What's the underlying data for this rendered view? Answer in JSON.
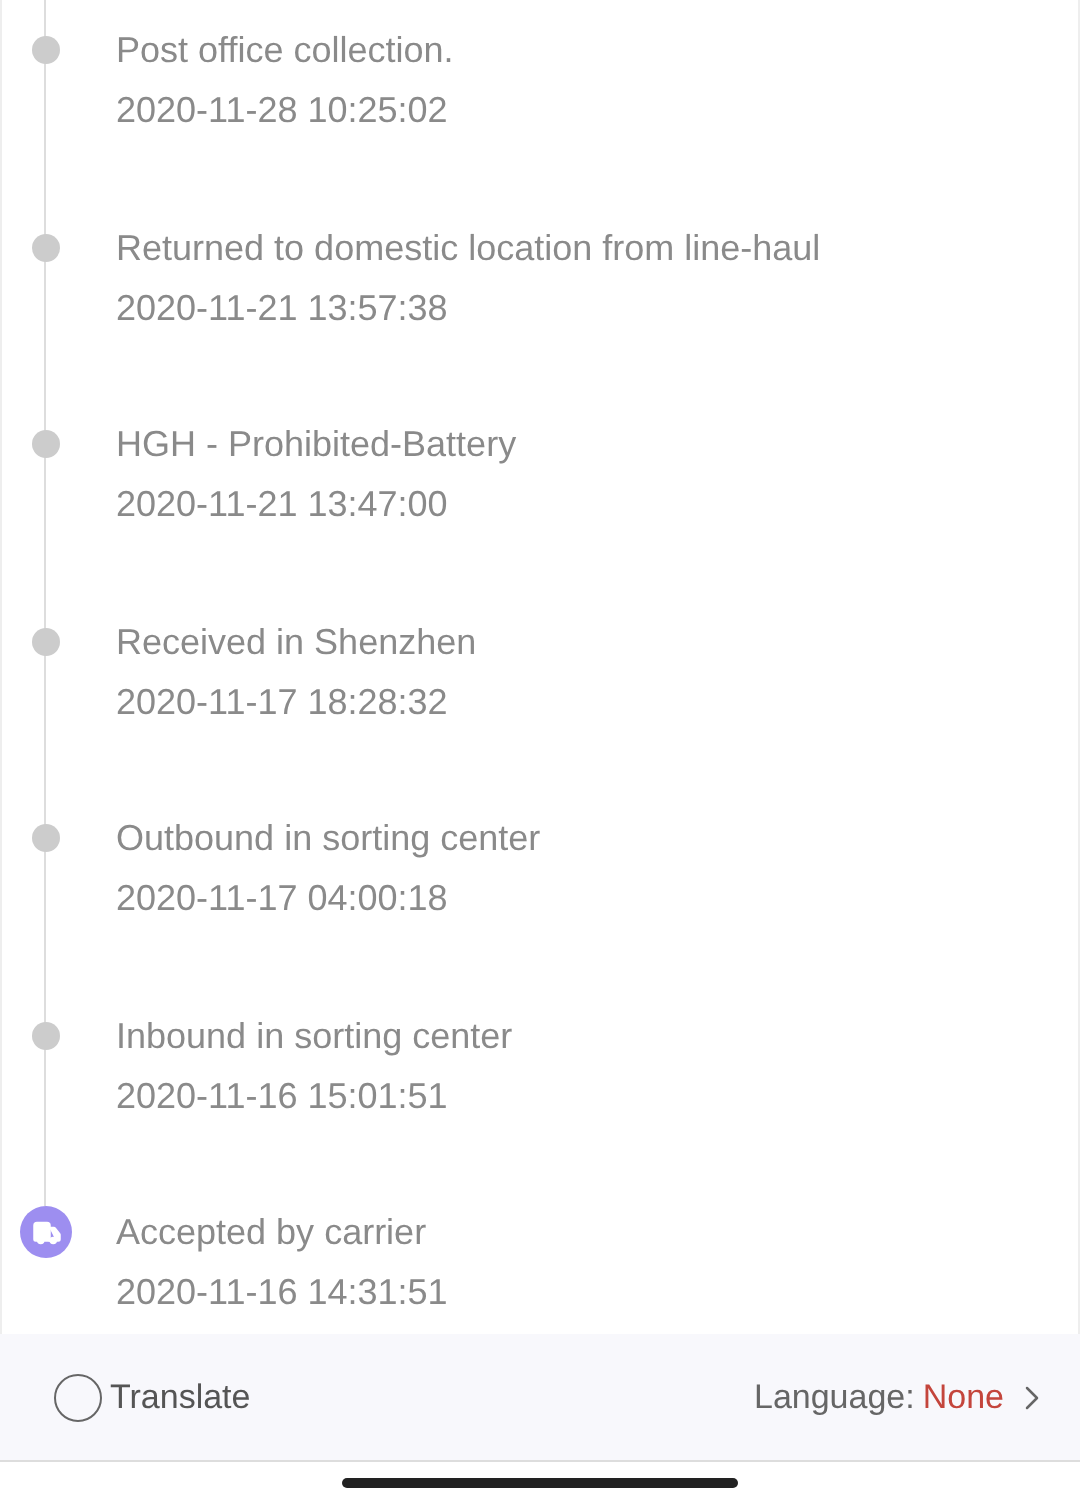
{
  "events": [
    {
      "kind": "dot",
      "title": "Post office collection.",
      "time": "2020-11-28 10:25:02"
    },
    {
      "kind": "dot",
      "title": "Returned to domestic location from line-haul",
      "time": "2020-11-21 13:57:38"
    },
    {
      "kind": "dot",
      "title": "HGH - Prohibited-Battery",
      "time": "2020-11-21 13:47:00"
    },
    {
      "kind": "dot",
      "title": "Received in Shenzhen",
      "time": "2020-11-17 18:28:32"
    },
    {
      "kind": "dot",
      "title": "Outbound in sorting center",
      "time": "2020-11-17 04:00:18"
    },
    {
      "kind": "dot",
      "title": "Inbound in sorting center",
      "time": "2020-11-16 15:01:51"
    },
    {
      "kind": "current",
      "title": "Accepted by carrier",
      "time": "2020-11-16 14:31:51"
    }
  ],
  "footer": {
    "translate": {
      "label": "Translate",
      "checked": false
    },
    "language_label": "Language:",
    "language_value": "None"
  }
}
